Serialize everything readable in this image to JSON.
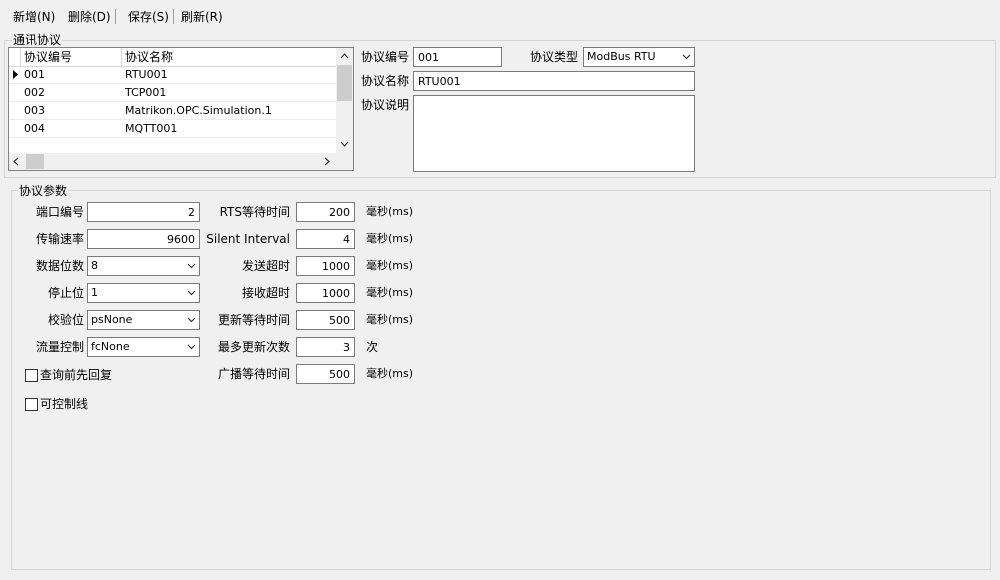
{
  "toolbar": {
    "add": "新增(N)",
    "delete": "删除(D)",
    "save": "保存(S)",
    "refresh": "刷新(R)"
  },
  "protocol_group": {
    "title": "通讯协议",
    "columns": [
      "协议编号",
      "协议名称"
    ],
    "rows": [
      {
        "id": "001",
        "name": "RTU001"
      },
      {
        "id": "002",
        "name": "TCP001"
      },
      {
        "id": "003",
        "name": "Matrikon.OPC.Simulation.1"
      },
      {
        "id": "004",
        "name": "MQTT001"
      }
    ],
    "selected_index": 0,
    "form": {
      "id_label": "协议编号",
      "id_value": "001",
      "type_label": "协议类型",
      "type_value": "ModBus RTU",
      "name_label": "协议名称",
      "name_value": "RTU001",
      "desc_label": "协议说明",
      "desc_value": ""
    }
  },
  "params_group": {
    "title": "协议参数",
    "port_label": "端口编号",
    "port_value": "2",
    "baud_label": "传输速率",
    "baud_value": "9600",
    "databits_label": "数据位数",
    "databits_value": "8",
    "stopbits_label": "停止位",
    "stopbits_value": "1",
    "parity_label": "校验位",
    "parity_value": "psNone",
    "flow_label": "流量控制",
    "flow_value": "fcNone",
    "query_first_label": "查询前先回复",
    "query_first_checked": false,
    "controllable_label": "可控制线",
    "controllable_checked": false,
    "rts_label": "RTS等待时间",
    "rts_value": "200",
    "silent_label": "Silent Interval",
    "silent_value": "4",
    "send_timeout_label": "发送超时",
    "send_timeout_value": "1000",
    "recv_timeout_label": "接收超时",
    "recv_timeout_value": "1000",
    "update_wait_label": "更新等待时间",
    "update_wait_value": "500",
    "max_update_label": "最多更新次数",
    "max_update_value": "3",
    "broadcast_wait_label": "广播等待时间",
    "broadcast_wait_value": "500",
    "unit_ms": "毫秒(ms)",
    "unit_times": "次"
  },
  "icons": [
    "row-pointer-icon",
    "chevron-down-icon",
    "chevron-up-icon",
    "chevron-left-icon",
    "chevron-right-icon"
  ],
  "colors": {
    "background": "#f0f0f0",
    "border": "#7a7a7a",
    "group_border": "#d5d5d5"
  }
}
